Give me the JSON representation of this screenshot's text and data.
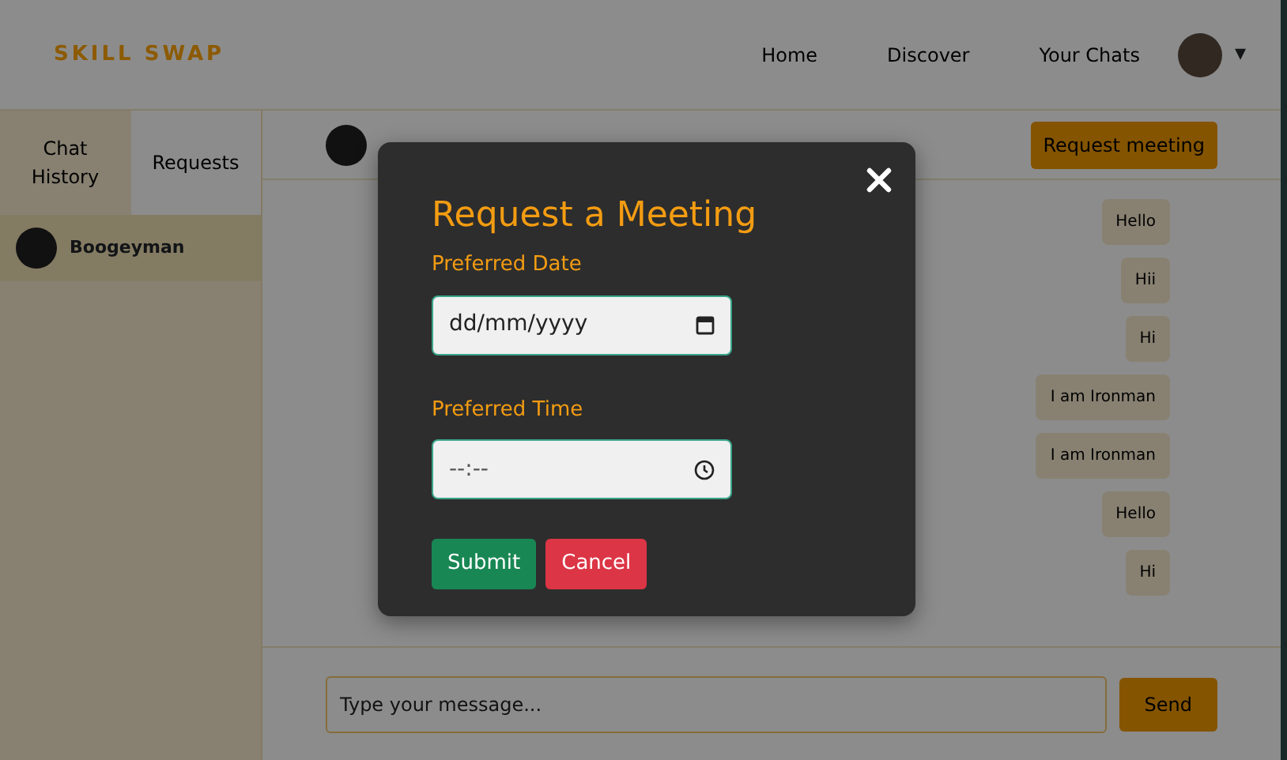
{
  "navbar": {
    "brand": "SKILL SWAP",
    "links": [
      "Home",
      "Discover",
      "Your Chats"
    ],
    "menu_caret": "▾"
  },
  "sidebar": {
    "tabs": [
      {
        "label": "Chat History",
        "selected": true
      },
      {
        "label": "Requests",
        "selected": false
      }
    ],
    "contacts": [
      {
        "name": "Boogeyman",
        "selected": true
      }
    ]
  },
  "chat": {
    "request_button": "Request meeting",
    "messages": [
      {
        "text": "Hello"
      },
      {
        "text": "Hii"
      },
      {
        "text": "Hi"
      },
      {
        "text": "I am Ironman"
      },
      {
        "text": "I am Ironman"
      },
      {
        "text": "Hello"
      },
      {
        "text": "Hi"
      }
    ],
    "input": {
      "placeholder": "Type your message..."
    },
    "send_button": "Send"
  },
  "modal": {
    "title": "Request a Meeting",
    "fields": [
      {
        "label": "Preferred Date",
        "kind": "date",
        "placeholder": "dd/mm/yyyy"
      },
      {
        "label": "Preferred Time",
        "kind": "time",
        "placeholder": "--:--"
      }
    ],
    "buttons": [
      {
        "label": "Submit",
        "kind": "submit"
      },
      {
        "label": "Cancel",
        "kind": "cancel"
      }
    ]
  }
}
